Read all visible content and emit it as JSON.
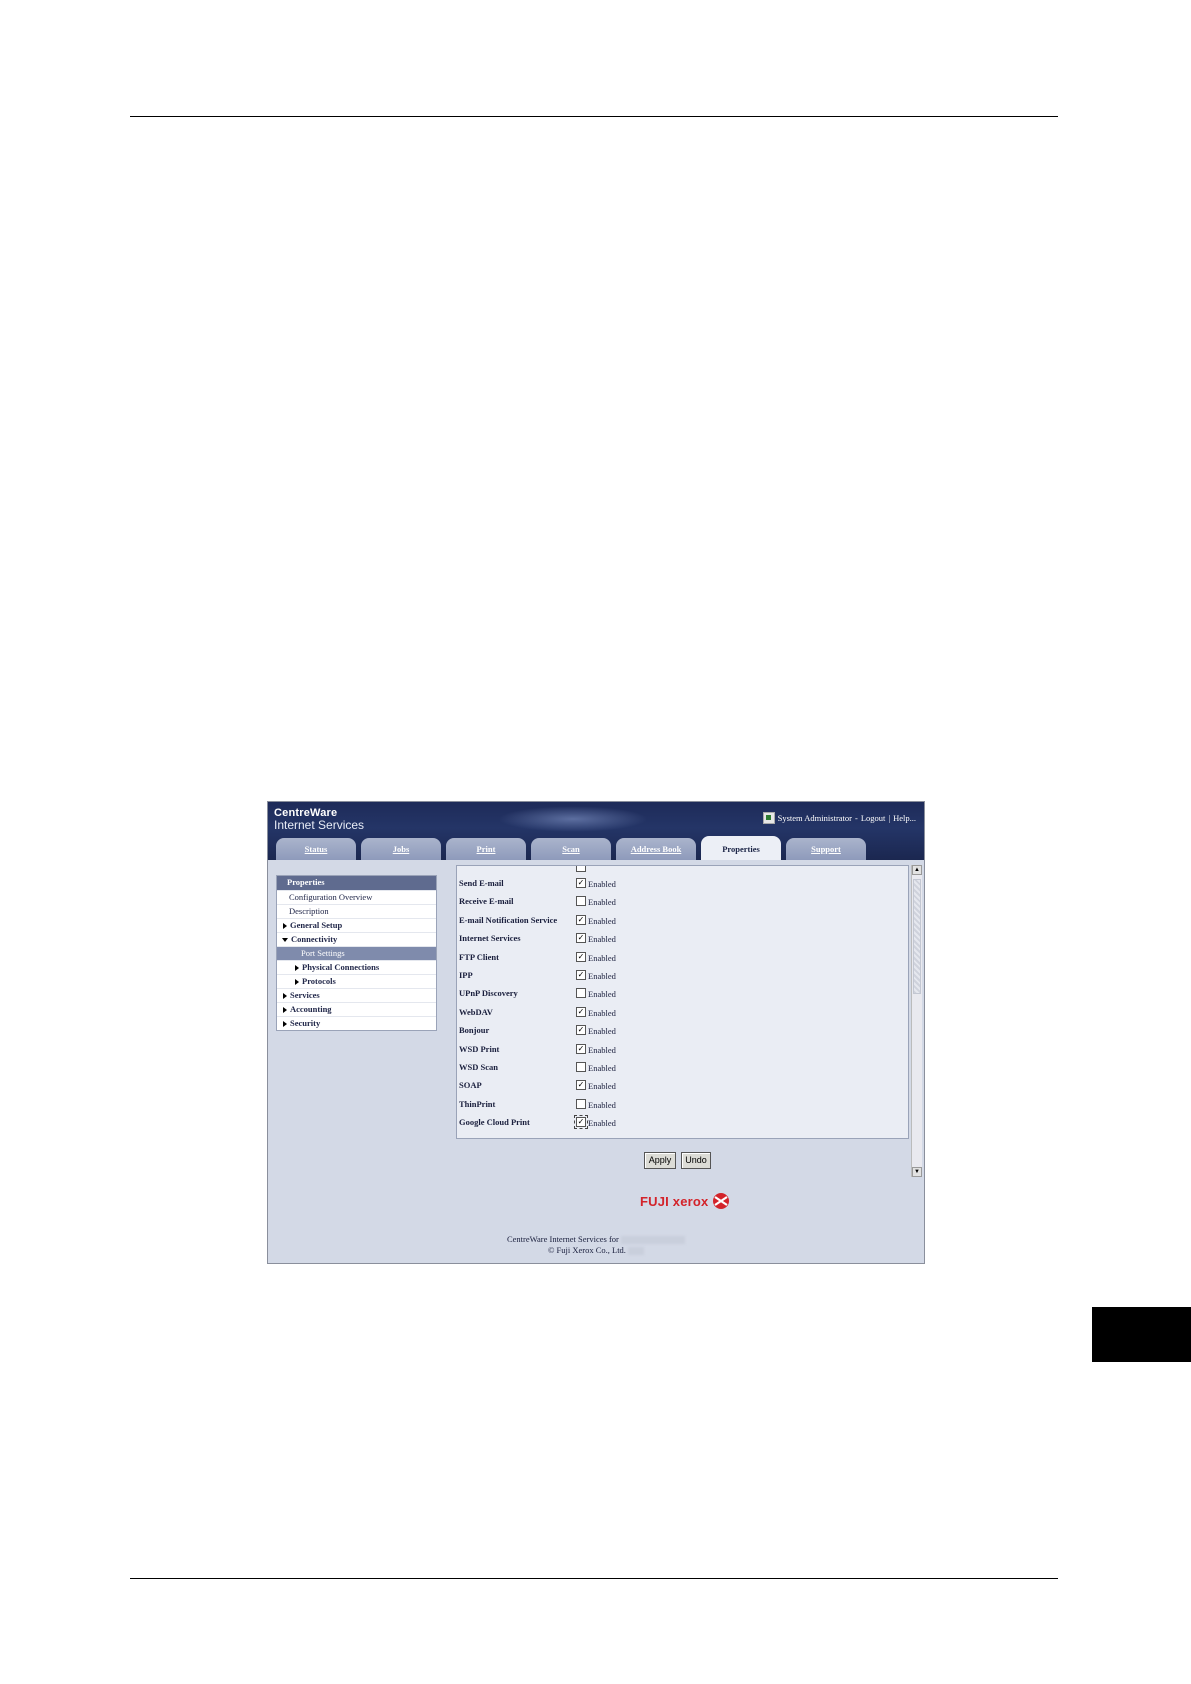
{
  "app": {
    "brand_line1": "CentreWare",
    "brand_line2": "Internet Services",
    "user": "System Administrator",
    "logout": "Logout",
    "help": "Help...",
    "separator1": " - ",
    "separator2": "|"
  },
  "tabs": [
    {
      "label": "Status",
      "active": false
    },
    {
      "label": "Jobs",
      "active": false
    },
    {
      "label": "Print",
      "active": false
    },
    {
      "label": "Scan",
      "active": false
    },
    {
      "label": "Address Book",
      "active": false
    },
    {
      "label": "Properties",
      "active": true
    },
    {
      "label": "Support",
      "active": false
    }
  ],
  "nav": {
    "title": "Properties",
    "items": [
      {
        "label": "Configuration Overview"
      },
      {
        "label": "Description"
      },
      {
        "label": "General Setup"
      },
      {
        "label": "Connectivity"
      },
      {
        "label": "Port Settings"
      },
      {
        "label": "Physical Connections"
      },
      {
        "label": "Protocols"
      },
      {
        "label": "Services"
      },
      {
        "label": "Accounting"
      },
      {
        "label": "Security"
      }
    ]
  },
  "ports": {
    "enabled_text": "Enabled",
    "rows": [
      {
        "label": "Send E-mail",
        "checked": true
      },
      {
        "label": "Receive E-mail",
        "checked": false
      },
      {
        "label": "E-mail Notification Service",
        "checked": true
      },
      {
        "label": "Internet Services",
        "checked": true
      },
      {
        "label": "FTP Client",
        "checked": true
      },
      {
        "label": "IPP",
        "checked": true
      },
      {
        "label": "UPnP Discovery",
        "checked": false
      },
      {
        "label": "WebDAV",
        "checked": true
      },
      {
        "label": "Bonjour",
        "checked": true
      },
      {
        "label": "WSD Print",
        "checked": true
      },
      {
        "label": "WSD Scan",
        "checked": false
      },
      {
        "label": "SOAP",
        "checked": true
      },
      {
        "label": "ThinPrint",
        "checked": false
      },
      {
        "label": "Google Cloud Print",
        "checked": true
      }
    ]
  },
  "buttons": {
    "apply": "Apply",
    "undo": "Undo"
  },
  "footer": {
    "logo": "FUJI xerox",
    "line1": "CentreWare Internet Services for",
    "line2": "© Fuji Xerox Co., Ltd."
  },
  "colors": {
    "brand_red": "#d3232a",
    "header_navy": "#1e2b59",
    "nav_selected": "#7f8bac"
  }
}
